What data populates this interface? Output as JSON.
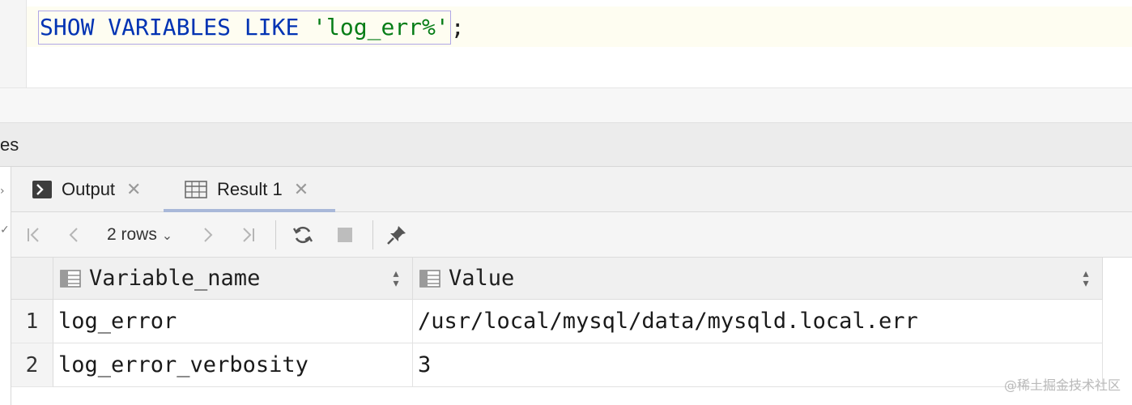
{
  "editor": {
    "sql_keyword_1": "SHOW",
    "sql_keyword_2": "VARIABLES",
    "sql_keyword_3": "LIKE",
    "sql_string": "'log_err%'",
    "sql_terminator": ";"
  },
  "panel": {
    "title": "es"
  },
  "tabs": [
    {
      "label": "Output",
      "icon": "console-icon"
    },
    {
      "label": "Result 1",
      "icon": "table-icon",
      "active": true
    }
  ],
  "toolbar": {
    "rows_label": "2 rows",
    "icons": [
      "first-page-icon",
      "prev-page-icon",
      "next-page-icon",
      "last-page-icon",
      "refresh-icon",
      "stop-icon",
      "pin-icon"
    ]
  },
  "grid": {
    "columns": [
      "Variable_name",
      "Value"
    ],
    "rows": [
      {
        "num": "1",
        "cells": [
          "log_error",
          "/usr/local/mysql/data/mysqld.local.err"
        ]
      },
      {
        "num": "2",
        "cells": [
          "log_error_verbosity",
          "3"
        ]
      }
    ]
  },
  "watermark": "@稀土掘金技术社区",
  "colors": {
    "keyword": "#0033b3",
    "string": "#067d17",
    "selection_border": "#b0a7e6",
    "active_tab_underline": "#a9b8d9"
  }
}
